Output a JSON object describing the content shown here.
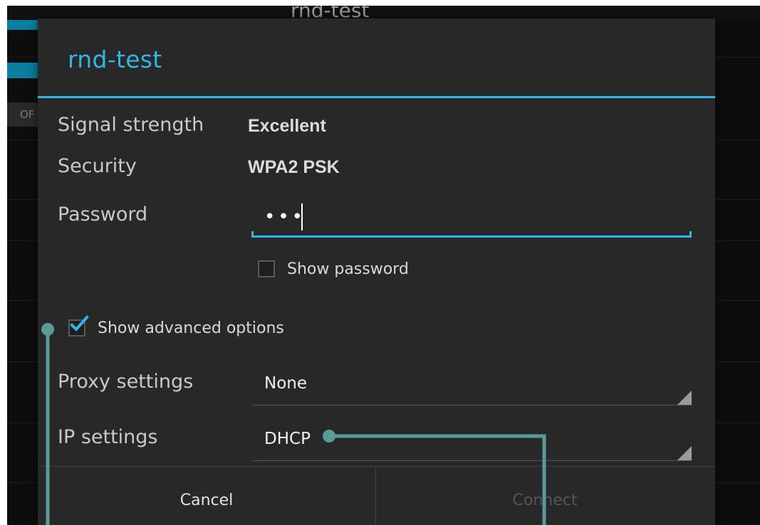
{
  "background": {
    "title": "rnd-test",
    "off_label": "OF"
  },
  "dialog": {
    "title": "rnd-test",
    "signal_strength": {
      "label": "Signal strength",
      "value": "Excellent"
    },
    "security": {
      "label": "Security",
      "value": "WPA2 PSK"
    },
    "password": {
      "label": "Password",
      "value": "•••"
    },
    "show_password": {
      "label": "Show password",
      "checked": false
    },
    "show_advanced": {
      "label": "Show advanced options",
      "checked": true
    },
    "proxy_settings": {
      "label": "Proxy settings",
      "value": "None"
    },
    "ip_settings": {
      "label": "IP settings",
      "value": "DHCP"
    },
    "buttons": {
      "cancel": "Cancel",
      "connect": "Connect"
    }
  },
  "colors": {
    "accent": "#33b5e5",
    "annotation": "#5b9a9a",
    "dialog_bg": "#282828"
  }
}
